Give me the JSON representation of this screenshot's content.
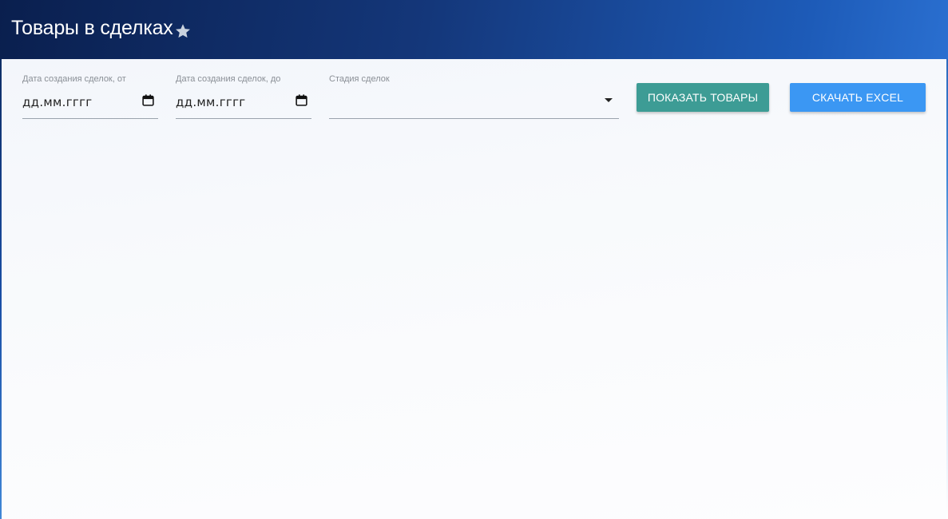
{
  "header": {
    "title": "Товары в сделках",
    "favorite_icon": "star-icon"
  },
  "filters": {
    "date_from": {
      "label": "Дата создания сделок, от",
      "value": "дд.мм.гггг",
      "icon": "calendar-icon"
    },
    "date_to": {
      "label": "Дата создания сделок, до",
      "value": "дд.мм.гггг",
      "icon": "calendar-icon"
    },
    "stage": {
      "label": "Стадия сделок",
      "value": "",
      "icon": "caret-down-icon"
    }
  },
  "actions": {
    "show_label": "ПОКАЗАТЬ ТОВАРЫ",
    "excel_label": "СКАЧАТЬ EXCEL"
  },
  "colors": {
    "show_button": "#3d9c95",
    "excel_button": "#3b97f3",
    "header_dark": "#0a1f4e",
    "header_light": "#2a6fd0"
  }
}
